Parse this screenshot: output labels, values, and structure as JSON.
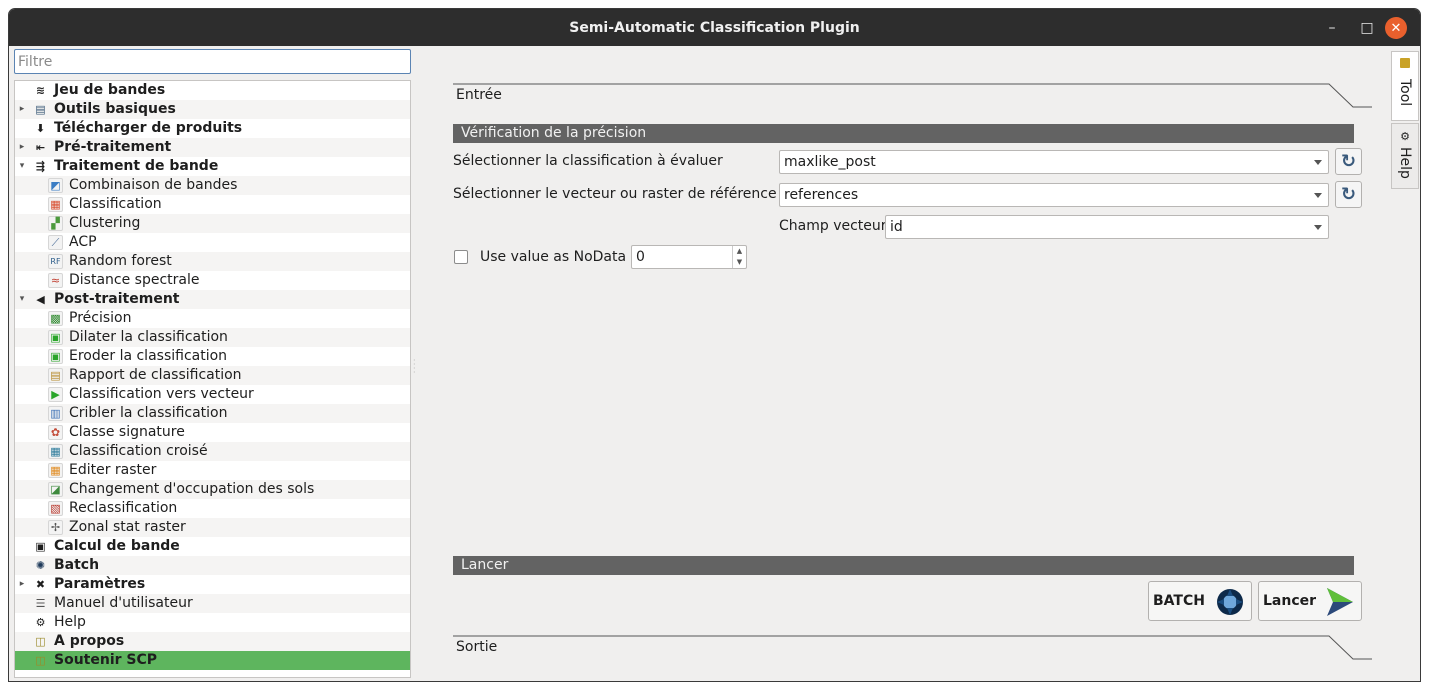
{
  "window": {
    "title": "Semi-Automatic Classification Plugin",
    "minimize": "–",
    "maximize": "□",
    "close": "✕"
  },
  "filter": {
    "placeholder": "Filtre",
    "value": ""
  },
  "tree": [
    {
      "label": "Jeu de bandes",
      "bold": true,
      "level": 0,
      "arrow": "",
      "icon": "band-set-icon",
      "color": "#2a2a2a",
      "glyph": "≋"
    },
    {
      "label": "Outils basiques",
      "bold": true,
      "level": 0,
      "arrow": "▸",
      "icon": "basic-tools-icon",
      "color": "#3c5a78",
      "glyph": "▤"
    },
    {
      "label": "Télécharger de produits",
      "bold": true,
      "level": 0,
      "arrow": "",
      "icon": "download-icon",
      "color": "#1e1e1e",
      "glyph": "⬇"
    },
    {
      "label": "Pré-traitement",
      "bold": true,
      "level": 0,
      "arrow": "▸",
      "icon": "preprocessing-icon",
      "color": "#1e1e1e",
      "glyph": "⇤"
    },
    {
      "label": "Traitement de bande",
      "bold": true,
      "level": 0,
      "arrow": "▾",
      "icon": "band-processing-icon",
      "color": "#1e1e1e",
      "glyph": "⇶"
    },
    {
      "label": "Combinaison de bandes",
      "bold": false,
      "level": 1,
      "arrow": "",
      "icon": "band-combination-icon",
      "color": "#3b7dc4",
      "glyph": "◩"
    },
    {
      "label": "Classification",
      "bold": false,
      "level": 1,
      "arrow": "",
      "icon": "classification-icon",
      "color": "#d84a2b",
      "glyph": "▦"
    },
    {
      "label": "Clustering",
      "bold": false,
      "level": 1,
      "arrow": "",
      "icon": "clustering-icon",
      "color": "#4c9a3d",
      "glyph": "▞"
    },
    {
      "label": "ACP",
      "bold": false,
      "level": 1,
      "arrow": "",
      "icon": "pca-icon",
      "color": "#4a6d99",
      "glyph": "⟋"
    },
    {
      "label": "Random forest",
      "bold": false,
      "level": 1,
      "arrow": "",
      "icon": "random-forest-icon",
      "color": "#2c5d8a",
      "glyph": "RF"
    },
    {
      "label": "Distance spectrale",
      "bold": false,
      "level": 1,
      "arrow": "",
      "icon": "spectral-distance-icon",
      "color": "#c0392b",
      "glyph": "≈"
    },
    {
      "label": "Post-traitement",
      "bold": true,
      "level": 0,
      "arrow": "▾",
      "icon": "postprocessing-icon",
      "color": "#1e1e1e",
      "glyph": "◀"
    },
    {
      "label": "Précision",
      "bold": false,
      "level": 1,
      "arrow": "",
      "icon": "accuracy-icon",
      "color": "#2f8a2f",
      "glyph": "▩"
    },
    {
      "label": "Dilater la classification",
      "bold": false,
      "level": 1,
      "arrow": "",
      "icon": "dilate-icon",
      "color": "#2aa52a",
      "glyph": "▣"
    },
    {
      "label": "Eroder la classification",
      "bold": false,
      "level": 1,
      "arrow": "",
      "icon": "erode-icon",
      "color": "#2aa52a",
      "glyph": "▣"
    },
    {
      "label": "Rapport de classification",
      "bold": false,
      "level": 1,
      "arrow": "",
      "icon": "report-icon",
      "color": "#b58a2a",
      "glyph": "▤"
    },
    {
      "label": "Classification vers vecteur",
      "bold": false,
      "level": 1,
      "arrow": "",
      "icon": "to-vector-icon",
      "color": "#2aa52a",
      "glyph": "▶"
    },
    {
      "label": "Cribler la classification",
      "bold": false,
      "level": 1,
      "arrow": "",
      "icon": "sieve-icon",
      "color": "#3b6fb5",
      "glyph": "▥"
    },
    {
      "label": "Classe signature",
      "bold": false,
      "level": 1,
      "arrow": "",
      "icon": "class-signature-icon",
      "color": "#c44d3a",
      "glyph": "✿"
    },
    {
      "label": "Classification croisé",
      "bold": false,
      "level": 1,
      "arrow": "",
      "icon": "cross-classification-icon",
      "color": "#2a7a9a",
      "glyph": "▦"
    },
    {
      "label": "Editer raster",
      "bold": false,
      "level": 1,
      "arrow": "",
      "icon": "edit-raster-icon",
      "color": "#e08a1e",
      "glyph": "▦"
    },
    {
      "label": "Changement d'occupation des sols",
      "bold": false,
      "level": 1,
      "arrow": "",
      "icon": "land-cover-change-icon",
      "color": "#3e8a3e",
      "glyph": "◪"
    },
    {
      "label": "Reclassification",
      "bold": false,
      "level": 1,
      "arrow": "",
      "icon": "reclassification-icon",
      "color": "#b8352a",
      "glyph": "▧"
    },
    {
      "label": "Zonal stat raster",
      "bold": false,
      "level": 1,
      "arrow": "",
      "icon": "zonal-stat-icon",
      "color": "#555555",
      "glyph": "✢"
    },
    {
      "label": "Calcul de bande",
      "bold": true,
      "level": 0,
      "arrow": "",
      "icon": "band-calc-icon",
      "color": "#1e1e1e",
      "glyph": "▣"
    },
    {
      "label": "Batch",
      "bold": true,
      "level": 0,
      "arrow": "",
      "icon": "batch-icon",
      "color": "#1e3a5a",
      "glyph": "✺"
    },
    {
      "label": "Paramètres",
      "bold": true,
      "level": 0,
      "arrow": "▸",
      "icon": "settings-icon",
      "color": "#1e1e1e",
      "glyph": "✖"
    },
    {
      "label": "Manuel d'utilisateur",
      "bold": false,
      "level": 0,
      "arrow": "",
      "icon": "user-manual-icon",
      "color": "#555555",
      "glyph": "☰"
    },
    {
      "label": "Help",
      "bold": false,
      "level": 0,
      "arrow": "",
      "icon": "help-icon",
      "color": "#1e1e1e",
      "glyph": "⚙"
    },
    {
      "label": "A propos",
      "bold": true,
      "level": 0,
      "arrow": "",
      "icon": "about-icon",
      "color": "#9a8a2a",
      "glyph": "◫"
    },
    {
      "label": "Soutenir SCP",
      "bold": true,
      "level": 0,
      "arrow": "",
      "icon": "support-icon",
      "color": "#9a8a2a",
      "glyph": "◫",
      "selected": true
    }
  ],
  "main": {
    "input_section": "Entrée",
    "group_title": "Vérification de la précision",
    "classification_label": "Sélectionner la classification à évaluer",
    "classification_value": "maxlike_post",
    "reference_label": "Sélectionner le vecteur ou raster de référence",
    "reference_value": "references",
    "vector_field_label": "Champ vecteur",
    "vector_field_value": "id",
    "nodata_label": "Use value as NoData",
    "nodata_value": "0",
    "run_group": "Lancer",
    "batch_button": "BATCH",
    "run_button": "Lancer",
    "output_section": "Sortie"
  },
  "side_tabs": {
    "tool": "Tool",
    "help": "Help"
  }
}
